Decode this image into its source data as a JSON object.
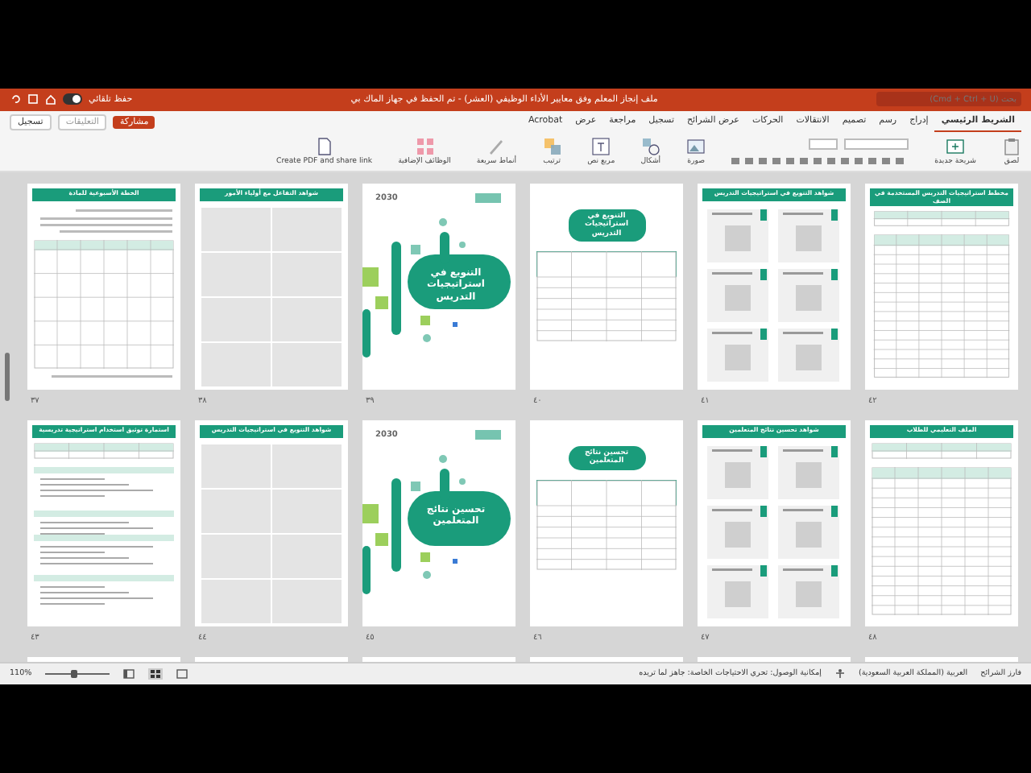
{
  "window": {
    "title": "ملف إنجاز المعلم وفق معايير الأداء الوظيفي (العشر) - تم الحفظ في جهاز الماك بي",
    "search_placeholder": "بحث (Cmd + Ctrl + U)",
    "autosave_label": "حفظ تلقائي"
  },
  "header_buttons": [
    {
      "label": "مشاركة",
      "kind": "share"
    },
    {
      "label": "التعليقات",
      "kind": "comments"
    },
    {
      "label": "تسجيل",
      "kind": "record"
    }
  ],
  "tabs": [
    {
      "label": "الشريط الرئيسي",
      "selected": true
    },
    {
      "label": "إدراج",
      "selected": false
    },
    {
      "label": "رسم",
      "selected": false
    },
    {
      "label": "تصميم",
      "selected": false
    },
    {
      "label": "الانتقالات",
      "selected": false
    },
    {
      "label": "الحركات",
      "selected": false
    },
    {
      "label": "عرض الشرائح",
      "selected": false
    },
    {
      "label": "تسجيل",
      "selected": false
    },
    {
      "label": "مراجعة",
      "selected": false
    },
    {
      "label": "عرض",
      "selected": false
    },
    {
      "label": "Acrobat",
      "selected": false
    }
  ],
  "ribbon": [
    {
      "kind": "paste",
      "label": "لصق"
    },
    {
      "kind": "new-slide",
      "label": "شريحة جديدة"
    },
    {
      "kind": "text-format"
    },
    {
      "kind": "picture",
      "label": "صورة"
    },
    {
      "kind": "shapes",
      "label": "أشكال"
    },
    {
      "kind": "textbox",
      "label": "مربع نص"
    },
    {
      "kind": "arrange",
      "label": "ترتيب"
    },
    {
      "kind": "quick-styles",
      "label": "أنماط سريعة"
    },
    {
      "kind": "addins",
      "label": "الوظائف الإضافية"
    },
    {
      "kind": "pdf",
      "label": "Create PDF and share link"
    }
  ],
  "slides": [
    {
      "number": "٤٢",
      "kind": "big-table",
      "title": "مخطط استراتيجيات التدريس المستخدمة في الصف"
    },
    {
      "number": "٤١",
      "kind": "evidence-grid",
      "title": "شواهد التنويع في استراتيجيات التدريس"
    },
    {
      "number": "٤٠",
      "kind": "pill-table",
      "title": "التنويع في استراتيجيات التدريس"
    },
    {
      "number": "٣٩",
      "kind": "cover",
      "title": "التنويع في استراتيجيات التدريس",
      "logo_text": "2030"
    },
    {
      "number": "٣٨",
      "kind": "grid-blank",
      "title": "شواهد التفاعل مع أولياء الأمور"
    },
    {
      "number": "٣٧",
      "kind": "table-form",
      "title": "الخطة الأسبوعية للمادة"
    },
    {
      "number": "٤٨",
      "kind": "big-table",
      "title": "الملف التعليمي للطلاب"
    },
    {
      "number": "٤٧",
      "kind": "evidence-grid",
      "title": "شواهد تحسين نتائج المتعلمين"
    },
    {
      "number": "٤٦",
      "kind": "pill-table",
      "title": "تحسين نتائج المتعلمين"
    },
    {
      "number": "٤٥",
      "kind": "cover",
      "title": "تحسين نتائج المتعلمين",
      "logo_text": "2030"
    },
    {
      "number": "٤٤",
      "kind": "grid-blank",
      "title": "شواهد التنويع في استراتيجيات التدريس"
    },
    {
      "number": "٤٣",
      "kind": "form-sections",
      "title": "استمارة توثيق استخدام استراتيجية تدريسية"
    },
    {
      "kind": "cut-off"
    },
    {
      "kind": "cut-off"
    },
    {
      "kind": "cut-off"
    },
    {
      "kind": "cut-off"
    },
    {
      "kind": "cut-off"
    },
    {
      "kind": "cut-off"
    }
  ],
  "status_bar": {
    "view": "فارز الشرائح",
    "language": "العربية (المملكة العربية السعودية)",
    "accessibility": "إمكانية الوصول: تحري الاحتياجات الخاصة: جاهز لما تريده",
    "zoom": "110%",
    "zoom_slider": {
      "level": 0.45
    }
  }
}
